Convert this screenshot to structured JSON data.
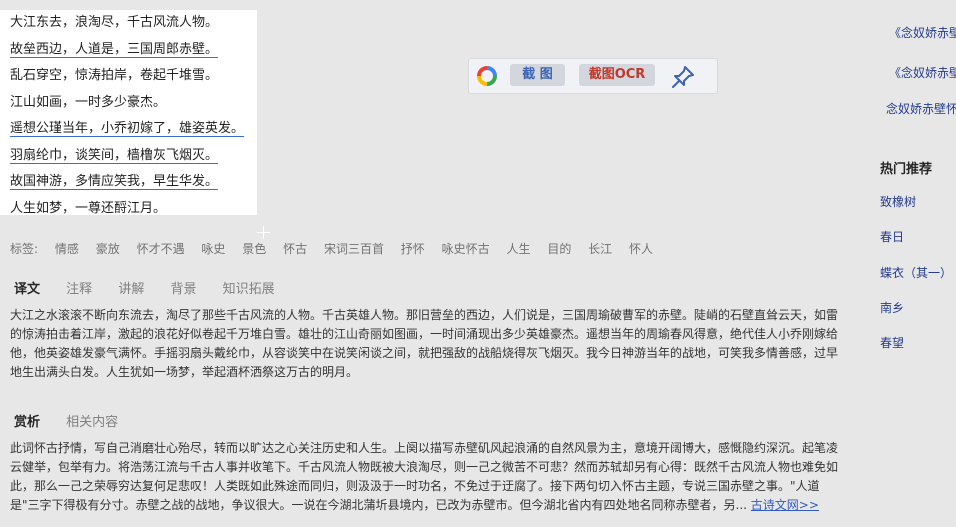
{
  "poem": {
    "lines": [
      {
        "text": "大江东去，浪淘尽，千古风流人物。"
      },
      {
        "text": "故垒西边，人道是，三国周郎赤壁。"
      },
      {
        "text": "乱石穿空，惊涛拍岸，卷起千堆雪。"
      },
      {
        "text": "江山如画，一时多少豪杰。"
      },
      {
        "text": "遥想公瑾当年，小乔初嫁了，雄姿英发。"
      },
      {
        "text": "羽扇纶巾，谈笑间，樯橹灰飞烟灭。"
      },
      {
        "text": "故国神游，多情应笑我，早生华发。"
      },
      {
        "text": "人生如梦，一尊还酹江月。"
      }
    ]
  },
  "toolbar": {
    "screenshot_label": "截 图",
    "ocr_label": "截图OCR"
  },
  "right_links": [
    "《念奴娇赤壁",
    "《念奴娇赤壁",
    "念奴娇赤壁怀"
  ],
  "hot": {
    "title": "热门推荐",
    "items": [
      "致橡树",
      "春日",
      "蝶衣（其一）",
      "南乡",
      "春望"
    ]
  },
  "tags": [
    "标签:",
    "情感",
    "豪放",
    "怀才不遇",
    "咏史",
    "景色",
    "怀古",
    "宋词三百首",
    "抒怀",
    "咏史怀古",
    "人生",
    "目的",
    "长江",
    "怀人"
  ],
  "translation_tabs": [
    "译文",
    "注释",
    "讲解",
    "背景",
    "知识拓展"
  ],
  "translation_text": "大江之水滚滚不断向东流去，淘尽了那些千古风流的人物。千古英雄人物。那旧营垒的西边，人们说是，三国周瑜破曹军的赤壁。陡峭的石壁直耸云天，如雷的惊涛拍击着江岸，激起的浪花好似卷起千万堆白雪。雄壮的江山奇丽如图画，一时间涌现出多少英雄豪杰。遥想当年的周瑜春风得意，绝代佳人小乔刚嫁给他，他英姿雄发豪气满怀。手摇羽扇头戴纶巾，从容谈笑中在说笑闲谈之间，就把强敌的战船烧得灰飞烟灭。我今日神游当年的战地，可笑我多情善感，过早地生出满头白发。人生犹如一场梦，举起酒杯洒祭这万古的明月。",
  "appreciation_tabs": [
    "赏析",
    "相关内容"
  ],
  "appreciation_text": "此词怀古抒情，写自己消磨壮心殆尽，转而以旷达之心关注历史和人生。上阕以描写赤壁矶风起浪涌的自然风景为主，意境开阔博大，感慨隐约深沉。起笔凌云健举，包举有力。将浩荡江流与千古人事并收笔下。千古风流人物既被大浪淘尽，则一己之微苦不可悲？然而苏轼却另有心得：既然千古风流人物也难免如此，那么一己之荣辱穷达复何足悲叹！人类既如此殊途而同归，则汲汲于一时功名，不免过于迂腐了。接下两句切入怀古主题，专说三国赤壁之事。\"人道是\"三字下得极有分寸。赤壁之战的战地，争议很大。一说在今湖北蒲圻县境内，已改为赤壁市。但今湖北省内有四处地名同称赤壁者，另...",
  "more_link": "古诗文网>>",
  "colors": {
    "link": "#1f3a9a",
    "more": "#2d5dd7",
    "ocr_text": "#c0392b",
    "screenshot_text": "#3c63b5"
  }
}
